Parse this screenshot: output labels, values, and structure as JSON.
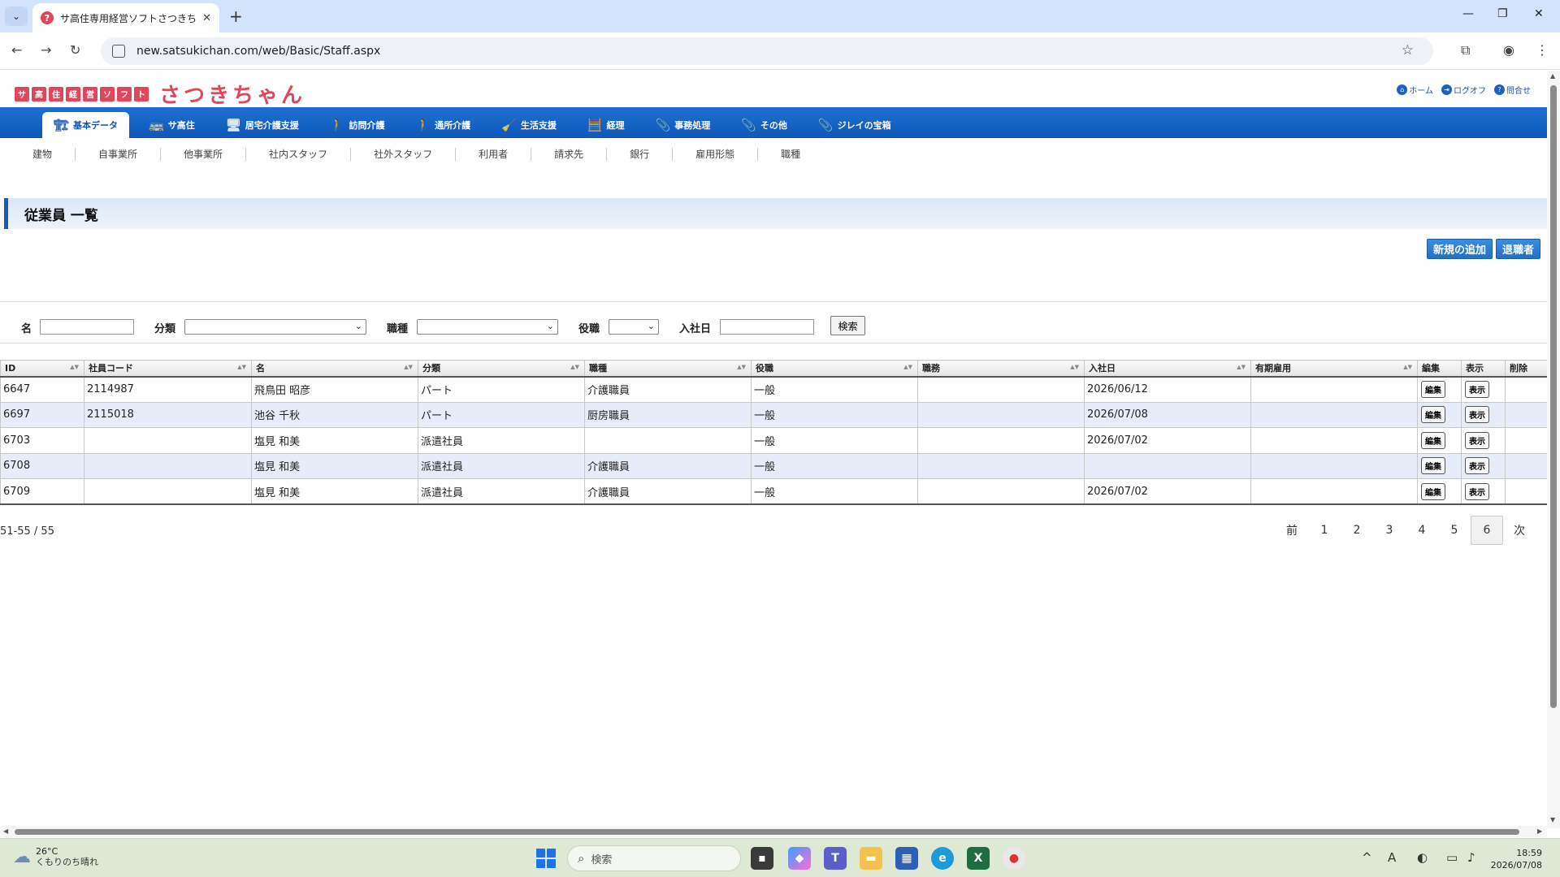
{
  "browser": {
    "tab_title": "サ高住専用経営ソフトさつきちゃん",
    "tab_favicon": "?",
    "url": "new.satsukichan.com/web/Basic/Staff.aspx"
  },
  "header": {
    "logo_boxes": [
      "サ",
      "高",
      "住",
      "経",
      "営",
      "ソ",
      "フ",
      "ト"
    ],
    "logo_text": "さつきちゃん",
    "links": [
      {
        "label": "ホーム",
        "icon": "home-icon"
      },
      {
        "label": "ログオフ",
        "icon": "logoff-icon"
      },
      {
        "label": "問合せ",
        "icon": "help-icon"
      }
    ]
  },
  "main_nav": [
    {
      "label": "基本データ",
      "icon": "🏗"
    },
    {
      "label": "サ高住",
      "icon": "🚌"
    },
    {
      "label": "居宅介護支援",
      "icon": "🖥"
    },
    {
      "label": "訪問介護",
      "icon": "🚶"
    },
    {
      "label": "通所介護",
      "icon": "🚶"
    },
    {
      "label": "生活支援",
      "icon": "🧹"
    },
    {
      "label": "経理",
      "icon": "🧮"
    },
    {
      "label": "事務処理",
      "icon": "📎"
    },
    {
      "label": "その他",
      "icon": "📎"
    },
    {
      "label": "ジレイの宝箱",
      "icon": "📎"
    }
  ],
  "sub_nav": [
    "建物",
    "自事業所",
    "他事業所",
    "社内スタッフ",
    "社外スタッフ",
    "利用者",
    "請求先",
    "銀行",
    "雇用形態",
    "職種"
  ],
  "page_title": "従業員 一覧",
  "actions": {
    "add": "新規の追加",
    "retired": "退職者"
  },
  "search": {
    "name_label": "名",
    "name_value": "",
    "category_label": "分類",
    "category_value": "",
    "job_label": "職種",
    "job_value": "",
    "position_label": "役職",
    "position_value": "",
    "hire_date_label": "入社日",
    "hire_date_value": "",
    "button": "検索"
  },
  "table": {
    "columns": [
      "ID",
      "社員コード",
      "名",
      "分類",
      "職種",
      "役職",
      "職務",
      "入社日",
      "有期雇用",
      "編集",
      "表示",
      "削除"
    ],
    "rows": [
      [
        "6647",
        "2114987",
        "飛鳥田 昭彦",
        "パート",
        "介護職員",
        "一般",
        "",
        "2026/06/12",
        ""
      ],
      [
        "6697",
        "2115018",
        "池谷 千秋",
        "パート",
        "厨房職員",
        "一般",
        "",
        "2026/07/08",
        ""
      ],
      [
        "6703",
        "",
        "塩見 和美",
        "派遣社員",
        "",
        "一般",
        "",
        "2026/07/02",
        ""
      ],
      [
        "6708",
        "",
        "塩見 和美",
        "派遣社員",
        "介護職員",
        "一般",
        "",
        "",
        ""
      ],
      [
        "6709",
        "",
        "塩見 和美",
        "派遣社員",
        "介護職員",
        "一般",
        "",
        "2026/07/02",
        ""
      ]
    ],
    "edit_label": "編集",
    "view_label": "表示"
  },
  "record_count": "51-55 / 55",
  "pager": {
    "prev": "前",
    "pages": [
      "1",
      "2",
      "3",
      "4",
      "5",
      "6"
    ],
    "current": "6",
    "next": "次"
  },
  "taskbar": {
    "weather_temp": "26°C",
    "weather_desc": "くもりのち晴れ",
    "search_placeholder": "検索",
    "time": "18:59",
    "date": "2026/07/08"
  }
}
